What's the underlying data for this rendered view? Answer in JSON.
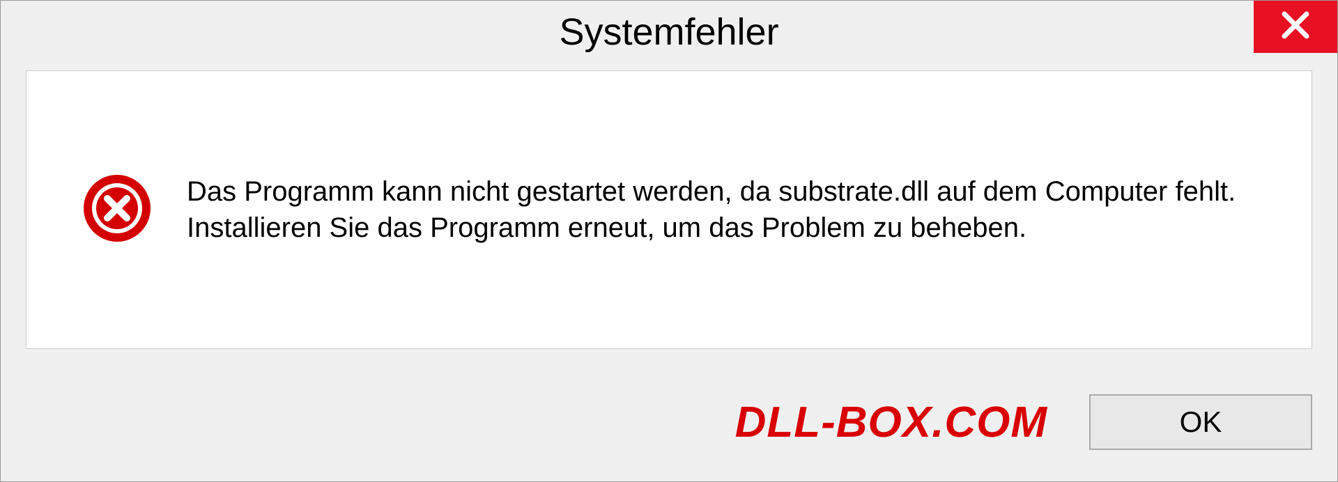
{
  "dialog": {
    "title": "Systemfehler",
    "message": "Das Programm kann nicht gestartet werden, da substrate.dll auf dem Computer fehlt. Installieren Sie das Programm erneut, um das Problem zu beheben.",
    "ok_label": "OK",
    "watermark": "DLL-BOX.COM"
  },
  "colors": {
    "close_bg": "#e81123",
    "error_icon": "#d40000",
    "watermark": "#d90000"
  }
}
